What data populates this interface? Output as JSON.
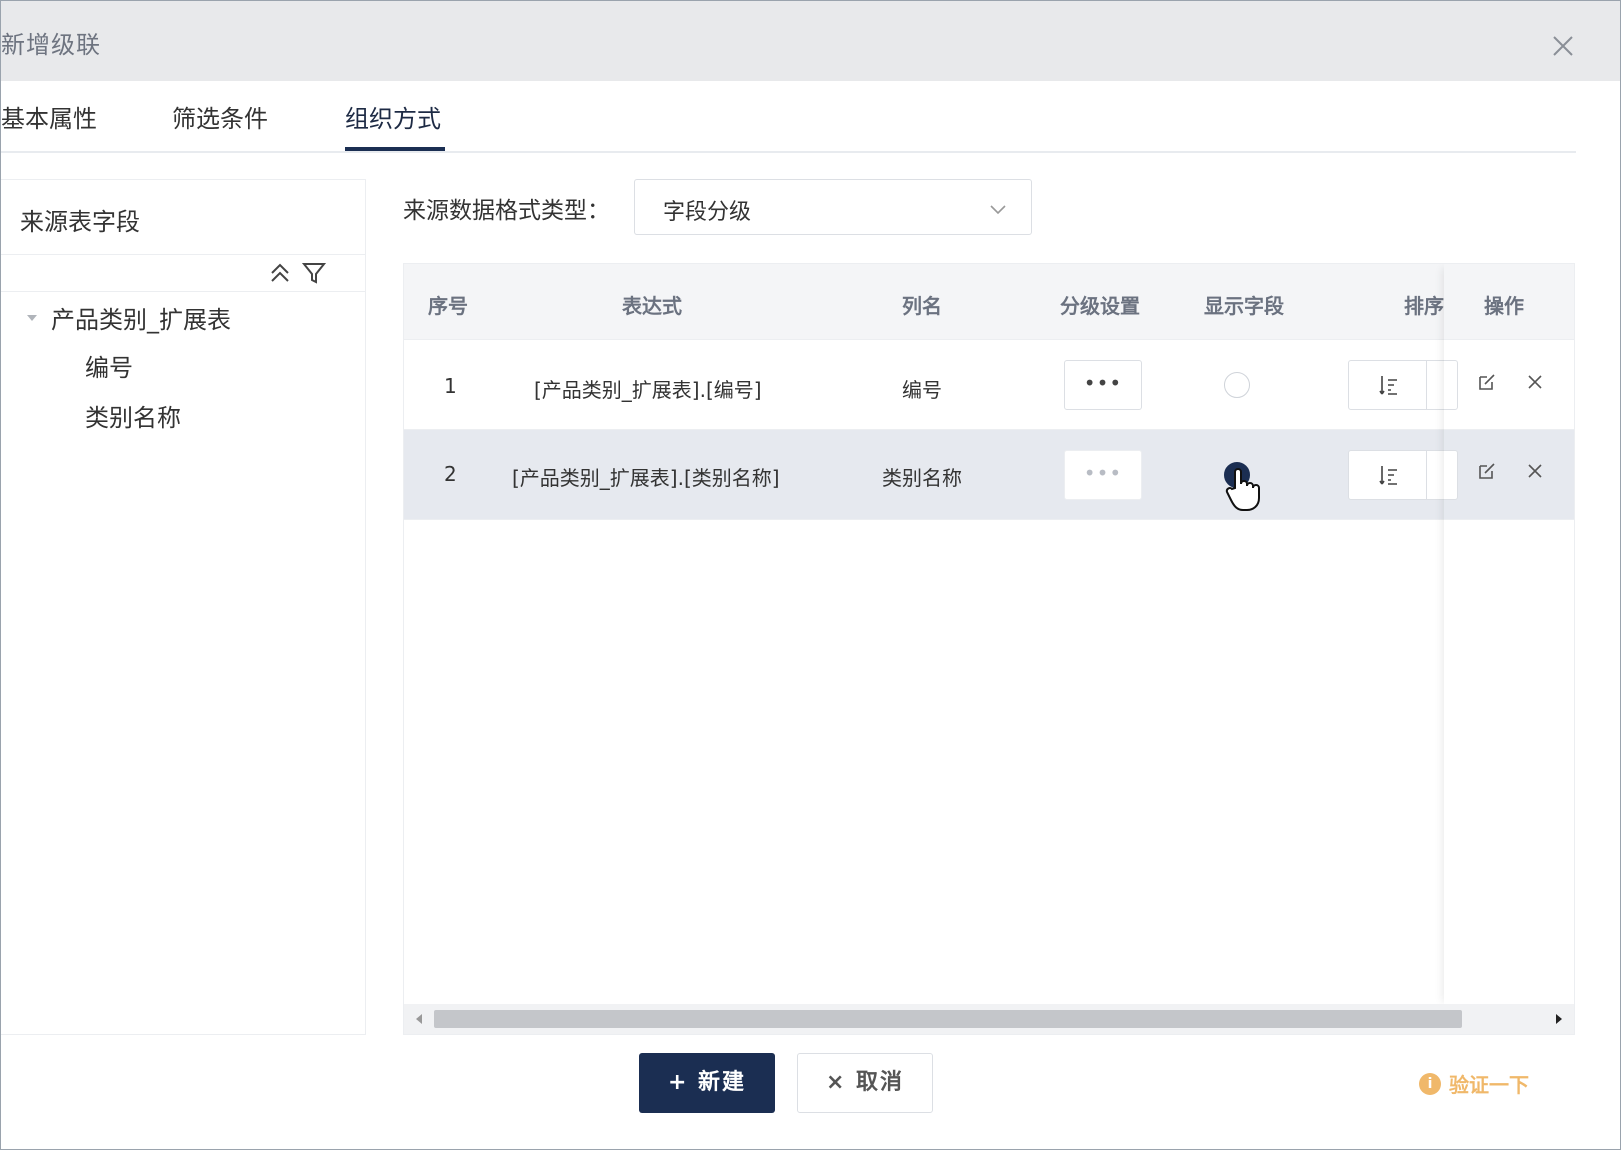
{
  "dialog": {
    "title": "新增级联"
  },
  "tabs": [
    {
      "label": "基本属性"
    },
    {
      "label": "筛选条件"
    },
    {
      "label": "组织方式"
    }
  ],
  "left_panel": {
    "title": "来源表字段",
    "tree": {
      "root": "产品类别_扩展表",
      "children": [
        "编号",
        "类别名称"
      ]
    }
  },
  "format": {
    "label": "来源数据格式类型：",
    "selected": "字段分级"
  },
  "table": {
    "headers": {
      "index": "序号",
      "expression": "表达式",
      "column": "列名",
      "level": "分级设置",
      "display": "显示字段",
      "sort": "排序",
      "ops": "操作"
    },
    "rows": [
      {
        "index": "1",
        "expression": "[产品类别_扩展表].[编号]",
        "column": "编号",
        "dots": "•••",
        "display_checked": false
      },
      {
        "index": "2",
        "expression": "[产品类别_扩展表].[类别名称]",
        "column": "类别名称",
        "dots": "•••",
        "display_checked": true
      }
    ]
  },
  "footer": {
    "new_label": "+ 新建",
    "cancel_label": "× 取消",
    "verify_label": "验证一下",
    "verify_badge": "i"
  },
  "colors": {
    "primary": "#1b2e52",
    "verify": "#f0b86a"
  }
}
